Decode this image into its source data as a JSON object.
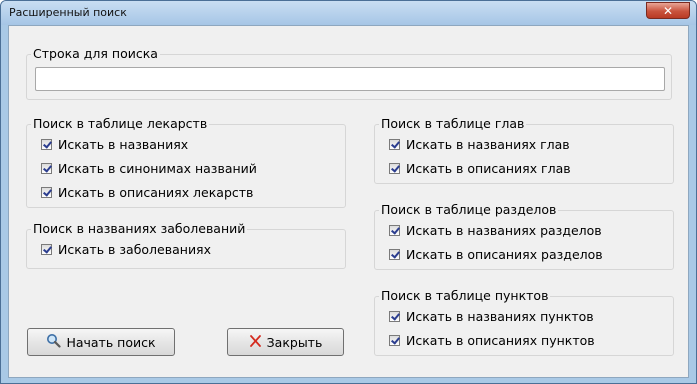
{
  "window": {
    "title": "Расширенный поиск",
    "close_glyph": "✕"
  },
  "search": {
    "group_title": "Строка для поиска",
    "value": ""
  },
  "drugs": {
    "group_title": "Поиск в таблице лекарств",
    "items": [
      {
        "label": "Искать в названиях",
        "checked": true
      },
      {
        "label": "Искать в синонимах названий",
        "checked": true
      },
      {
        "label": "Искать в описаниях лекарств",
        "checked": true
      }
    ]
  },
  "diseases": {
    "group_title": "Поиск в названиях заболеваний",
    "items": [
      {
        "label": "Искать в заболеваниях",
        "checked": true
      }
    ]
  },
  "chapters": {
    "group_title": "Поиск в таблице глав",
    "items": [
      {
        "label": "Искать в названиях глав",
        "checked": true
      },
      {
        "label": "Искать в описаниях глав",
        "checked": true
      }
    ]
  },
  "sections": {
    "group_title": "Поиск в таблице разделов",
    "items": [
      {
        "label": "Искать в названиях разделов",
        "checked": true
      },
      {
        "label": "Искать в описаниях разделов",
        "checked": true
      }
    ]
  },
  "points": {
    "group_title": "Поиск в таблице пунктов",
    "items": [
      {
        "label": "Искать в названиях пунктов",
        "checked": true
      },
      {
        "label": "Искать в описаниях пунктов",
        "checked": true
      }
    ]
  },
  "buttons": {
    "start_label": "Начать поиск",
    "start_icon": "magnifier-icon",
    "close_label": "Закрыть",
    "close_icon": "red-x-icon"
  },
  "colors": {
    "titlebar": "#a6c6e6",
    "close_button": "#c9533d",
    "client_bg": "#f0f0f0",
    "check_mark": "#2b3d8f"
  }
}
